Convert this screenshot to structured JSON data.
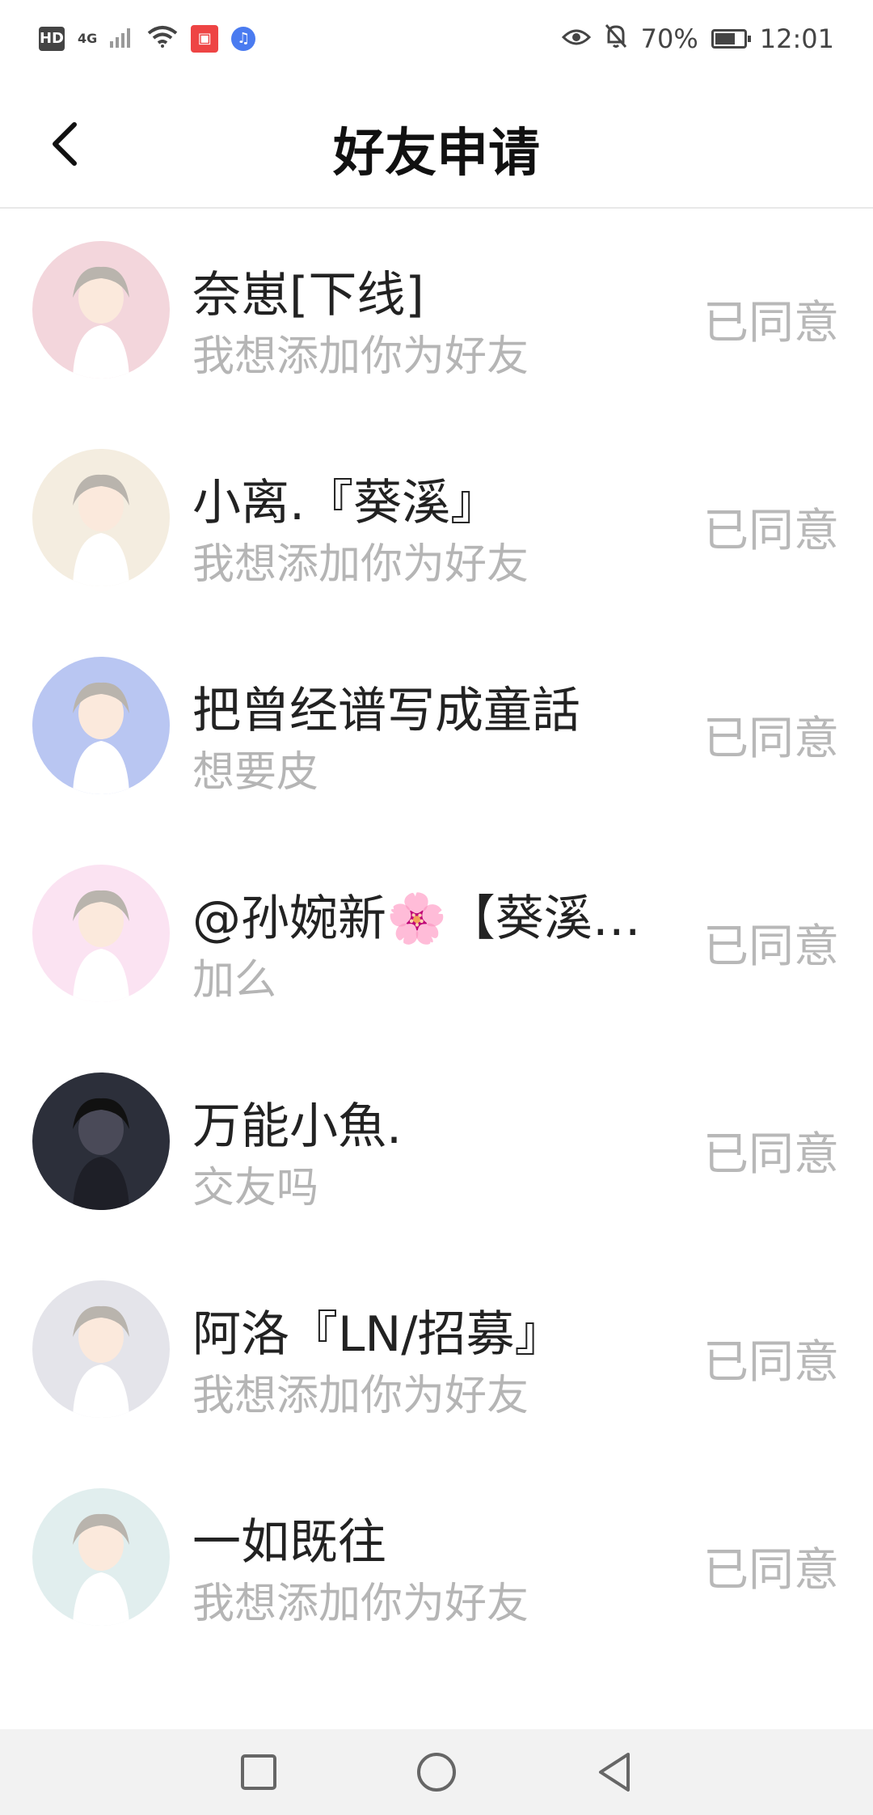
{
  "status_bar": {
    "hd": "HD",
    "network": "4G",
    "app_icon_1": "app-icon",
    "app_icon_2": "music-icon",
    "battery_text": "70%",
    "battery_level": 0.7,
    "time": "12:01"
  },
  "header": {
    "title": "好友申请"
  },
  "requests": [
    {
      "name": "奈崽[下线]",
      "message": "我想添加你为好友",
      "status": "已同意",
      "avatar_color": "#f3d6dc"
    },
    {
      "name": "小离.『葵溪』",
      "message": "我想添加你为好友",
      "status": "已同意",
      "avatar_color": "#f4ede0"
    },
    {
      "name": "把曾经谱写成童話",
      "message": "想要皮",
      "status": "已同意",
      "avatar_color": "#b9c6f2"
    },
    {
      "name": "@孙婉新🌸【葵溪…",
      "message": "加么",
      "status": "已同意",
      "avatar_color": "#fbe3f2"
    },
    {
      "name": "万能小魚.",
      "message": "交友吗",
      "status": "已同意",
      "avatar_color": "#2c2f3a"
    },
    {
      "name": "阿洛『LN/招募』",
      "message": "我想添加你为好友",
      "status": "已同意",
      "avatar_color": "#e4e4ea"
    },
    {
      "name": "一如既往",
      "message": "我想添加你为好友",
      "status": "已同意",
      "avatar_color": "#e1eeee"
    }
  ],
  "colors": {
    "name_text": "#222222",
    "message_text": "#b5b5b5",
    "status_text": "#b8b8b8",
    "divider": "#e8e8e8",
    "navbar_bg": "#f2f2f2"
  }
}
